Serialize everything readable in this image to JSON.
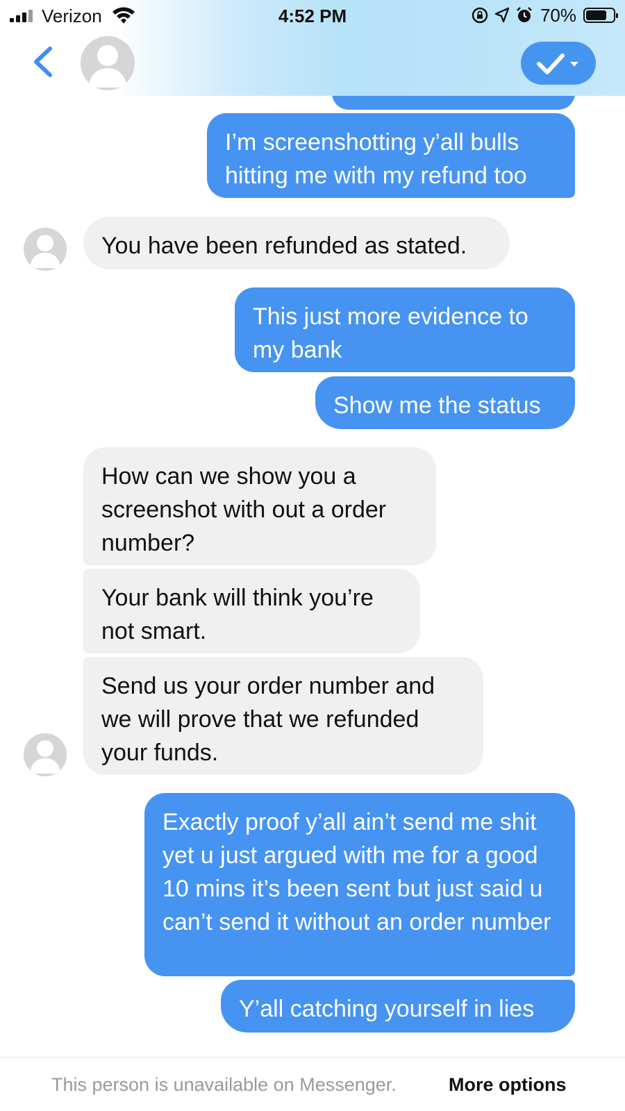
{
  "status_bar": {
    "carrier": "Verizon",
    "time": "4:52 PM",
    "battery": "70%",
    "icons": [
      "signal-icon",
      "wifi-icon",
      "rotation-lock-icon",
      "location-arrow-icon",
      "alarm-icon",
      "battery-icon"
    ]
  },
  "header": {
    "back_icon": "chevron-left-icon",
    "avatar_icon": "person-placeholder-icon",
    "action_icon": "checkmark-dropdown-icon",
    "accent_color": "#4595f0"
  },
  "messages": [
    {
      "from": "me",
      "text": "I’m screenshotting y’all bulls hitting me with my refund too"
    },
    {
      "from": "them",
      "text": "You have been refunded as stated."
    },
    {
      "from": "me",
      "text": "This just more evidence to my bank"
    },
    {
      "from": "me",
      "text": "Show me the status"
    },
    {
      "from": "them",
      "text": "How can we show you a screenshot with out a order number?"
    },
    {
      "from": "them",
      "text": "Your bank will think you’re not smart."
    },
    {
      "from": "them",
      "text": "Send us your order number and we will prove that we refunded your funds."
    },
    {
      "from": "me",
      "text": "Exactly proof y’all ain’t send me shit yet u just argued with me for a good 10 mins it’s been sent but just said u can’t send it without an order number"
    },
    {
      "from": "me",
      "text": "Y’all catching yourself in lies"
    }
  ],
  "colors": {
    "sent_bubble": "#4693f2",
    "received_bubble": "#f0f0f0"
  },
  "footer": {
    "note": "This person is unavailable on Messenger.",
    "more_options": "More options"
  }
}
